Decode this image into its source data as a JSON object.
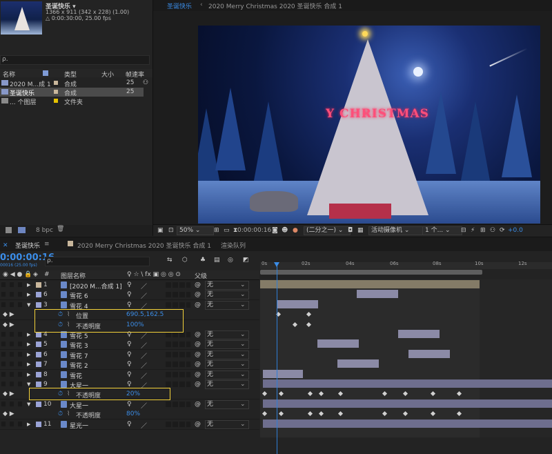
{
  "project": {
    "comp_name": "圣诞快乐 ▾",
    "comp_info1": "1366 x 911  (342 x 228) (1.00)",
    "comp_info2": "△ 0:00:30:00, 25.00 fps",
    "search_placeholder": "ρ.",
    "columns": {
      "name": "名称",
      "type": "类型",
      "size": "大小",
      "fps": "帧速率"
    },
    "items": [
      {
        "name": "2020 M...成 1",
        "type": "合成",
        "fps": "25",
        "color": "#c9b79c"
      },
      {
        "name": "圣诞快乐",
        "type": "合成",
        "fps": "25",
        "color": "#c9b79c",
        "selected": true
      },
      {
        "name": "... 个图层",
        "type": "文件夹",
        "fps": "",
        "color": "#e6c200"
      }
    ],
    "bpc": "8 bpc"
  },
  "viewer": {
    "tab_label": "圣诞快乐",
    "tab_title": "2020 Merry Christmas 2020 圣诞快乐  合成  1",
    "scene_text": "Y CHRISTMAS",
    "zoom": "50%",
    "timecode": "0:00:00:16",
    "resolution": "(二分之一)",
    "camera": "活动摄像机",
    "views": "1 个...",
    "exposure": "+0.0"
  },
  "timeline": {
    "tabs": [
      "圣诞快乐",
      "2020 Merry Christmas 2020 圣诞快乐  合成 1",
      "渲染队列"
    ],
    "timecode": "0:00:00:16",
    "fps_label": "00016 (25.00 fps)",
    "search_placeholder": "ρ.",
    "header": {
      "layer_name": "图层名称",
      "switches": "♀ ☆ \\ fx ▣ ◎ ◎ ⊙",
      "parent": "父级"
    },
    "ticks": [
      "0s",
      "02s",
      "04s",
      "06s",
      "08s",
      "10s",
      "12s"
    ],
    "parent_none": "无",
    "layers": [
      {
        "num": "1",
        "name": "[2020 M...合成 1]",
        "label": "#c9b79c",
        "expanded": false
      },
      {
        "num": "6",
        "name": "雪花 6",
        "label": "#9aa3d6",
        "expanded": false
      },
      {
        "num": "3",
        "name": "雪花 4",
        "label": "#9aa3d6",
        "expanded": true
      },
      {
        "prop": true,
        "name": "位置",
        "value": "690.5,162.5"
      },
      {
        "prop": true,
        "name": "不透明度",
        "value": "100%"
      },
      {
        "num": "4",
        "name": "雪花 5",
        "label": "#9aa3d6",
        "expanded": false
      },
      {
        "num": "5",
        "name": "雪花 3",
        "label": "#9aa3d6",
        "expanded": false
      },
      {
        "num": "6",
        "name": "雪花 7",
        "label": "#9aa3d6",
        "expanded": false
      },
      {
        "num": "7",
        "name": "雪花 2",
        "label": "#9aa3d6",
        "expanded": false
      },
      {
        "num": "8",
        "name": "雪花",
        "label": "#9aa3d6",
        "expanded": false
      },
      {
        "num": "9",
        "name": "大星一",
        "label": "#9aa3d6",
        "expanded": true
      },
      {
        "prop": true,
        "name": "不透明度",
        "value": "20%"
      },
      {
        "num": "10",
        "name": "大星一",
        "label": "#9aa3d6",
        "expanded": true
      },
      {
        "prop": true,
        "name": "不透明度",
        "value": "80%"
      },
      {
        "num": "11",
        "name": "星光一",
        "label": "#9aa3d6",
        "expanded": false
      }
    ]
  }
}
